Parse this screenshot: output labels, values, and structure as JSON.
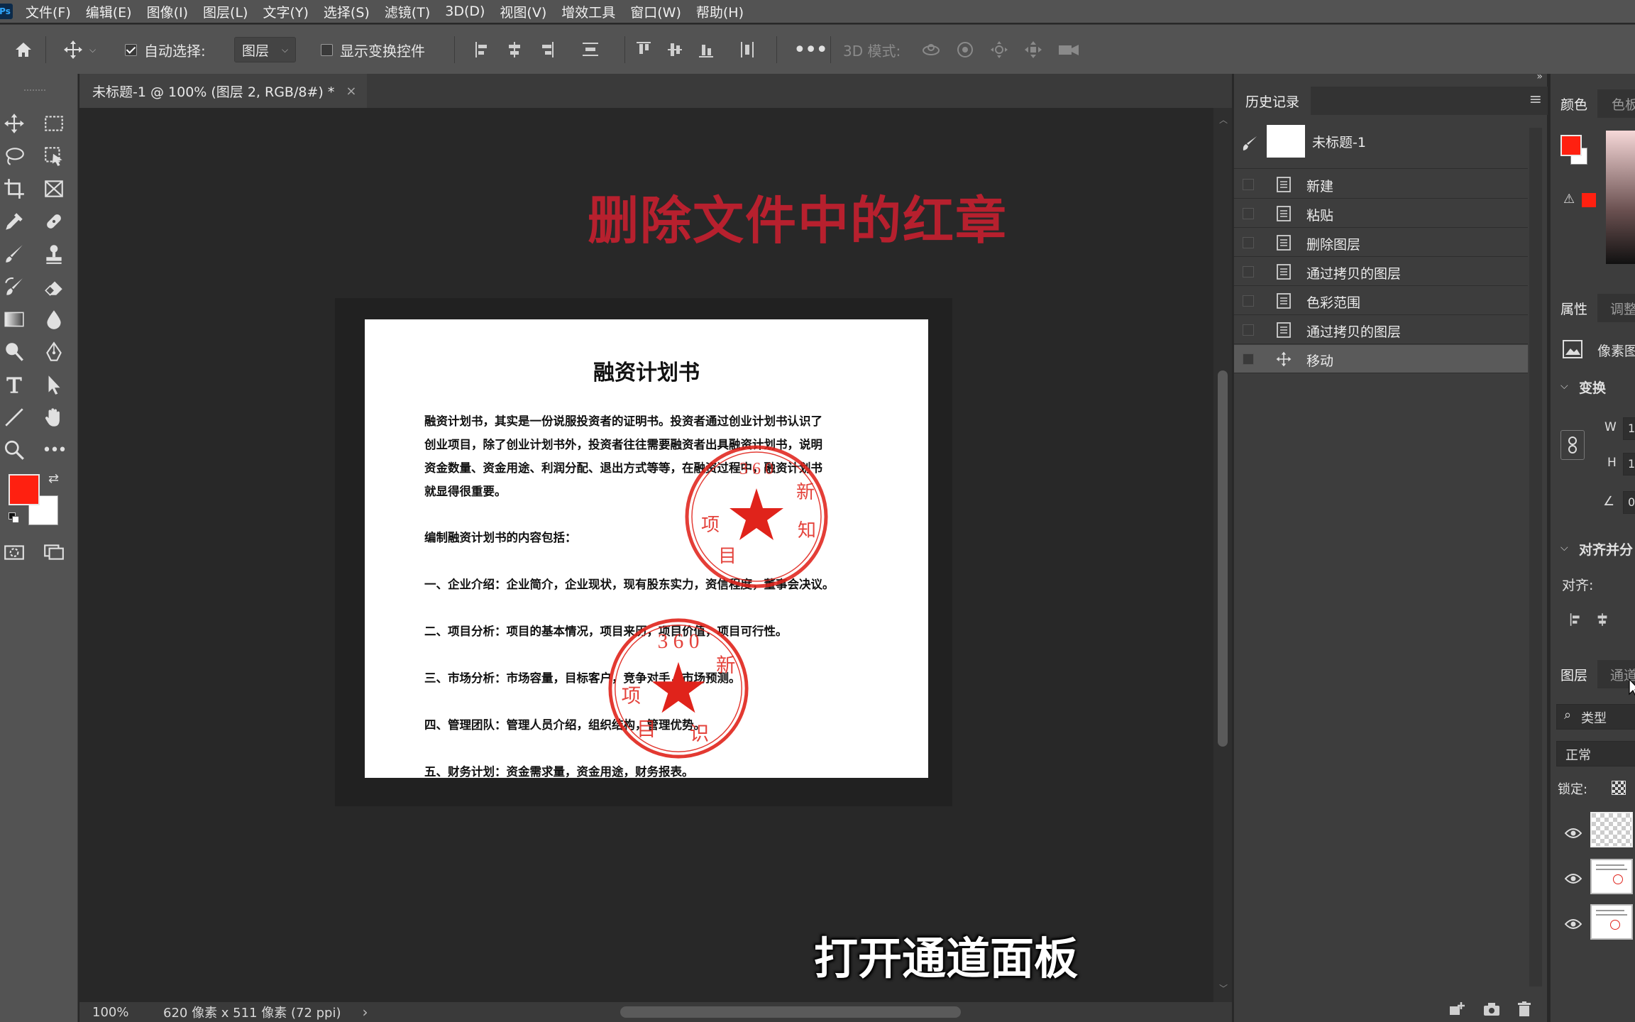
{
  "app": {
    "logo": "Ps"
  },
  "menu": [
    "文件(F)",
    "编辑(E)",
    "图像(I)",
    "图层(L)",
    "文字(Y)",
    "选择(S)",
    "滤镜(T)",
    "3D(D)",
    "视图(V)",
    "增效工具",
    "窗口(W)",
    "帮助(H)"
  ],
  "options": {
    "auto_select_label": "自动选择:",
    "auto_select_checked": true,
    "layer_dropdown": "图层",
    "transform_controls_label": "显示变换控件",
    "transform_controls_checked": false,
    "mode_3d_label": "3D 模式:"
  },
  "document": {
    "tab_title": "未标题-1 @ 100% (图层 2, RGB/8#) *",
    "close_glyph": "×",
    "overlay_title": "删除文件中的红章",
    "heading": "融资计划书",
    "lines": [
      "融资计划书，其实是一份说服投资者的证明书。投资者通过创业计划书认识了",
      "创业项目，除了创业计划书外，投资者往往需要融资者出具融资计划书，说明",
      "资金数量、资金用途、利润分配、退出方式等等，在融资过程中，融资计划书",
      "就显得很重要。",
      "编制融资计划书的内容包括：",
      "一、企业介绍：企业简介，企业现状，现有股东实力，资信程度，董事会决议。",
      "二、项目分析：项目的基本情况，项目来历，项目价值，项目可行性。",
      "三、市场分析：市场容量，目标客户，竞争对手，市场预测。",
      "四、管理团队：管理人员介绍，组织结构，管理优势。",
      "五、财务计划：资金需求量，资金用途，财务报表。"
    ],
    "seal_text": "3 6 0 新 知 识 目 项",
    "caption": "打开通道面板",
    "zoom": "100%",
    "size_info": "620 像素 x 511 像素 (72 ppi)",
    "status_arrow": "›"
  },
  "history": {
    "tab": "历史记录",
    "snapshot": "未标题-1",
    "items": [
      {
        "label": "新建",
        "icon": "document-icon",
        "selected": false
      },
      {
        "label": "粘贴",
        "icon": "document-icon",
        "selected": false
      },
      {
        "label": "删除图层",
        "icon": "document-icon",
        "selected": false
      },
      {
        "label": "通过拷贝的图层",
        "icon": "document-icon",
        "selected": false
      },
      {
        "label": "色彩范围",
        "icon": "document-icon",
        "selected": false
      },
      {
        "label": "通过拷贝的图层",
        "icon": "document-icon",
        "selected": false
      },
      {
        "label": "移动",
        "icon": "move-icon",
        "selected": true
      }
    ]
  },
  "panels": {
    "color_tab": "颜色",
    "swatch_tab": "色板",
    "properties_tab": "属性",
    "adjust_tab": "调整",
    "pixel_label": "像素图",
    "transform_label": "变换",
    "w_label": "W",
    "h_label": "H",
    "w_value": "1",
    "h_value": "1",
    "angle_value": "0",
    "align_label": "对齐并分",
    "align_sub": "对齐:",
    "layers_tab": "图层",
    "channels_tab": "通道",
    "search_type": "类型",
    "blend_mode": "正常",
    "lock_label": "锁定:"
  },
  "colors": {
    "foreground": "#ff2010",
    "background": "#ffffff",
    "seal": "#e0231b",
    "overlay_title": "#b7202e"
  }
}
